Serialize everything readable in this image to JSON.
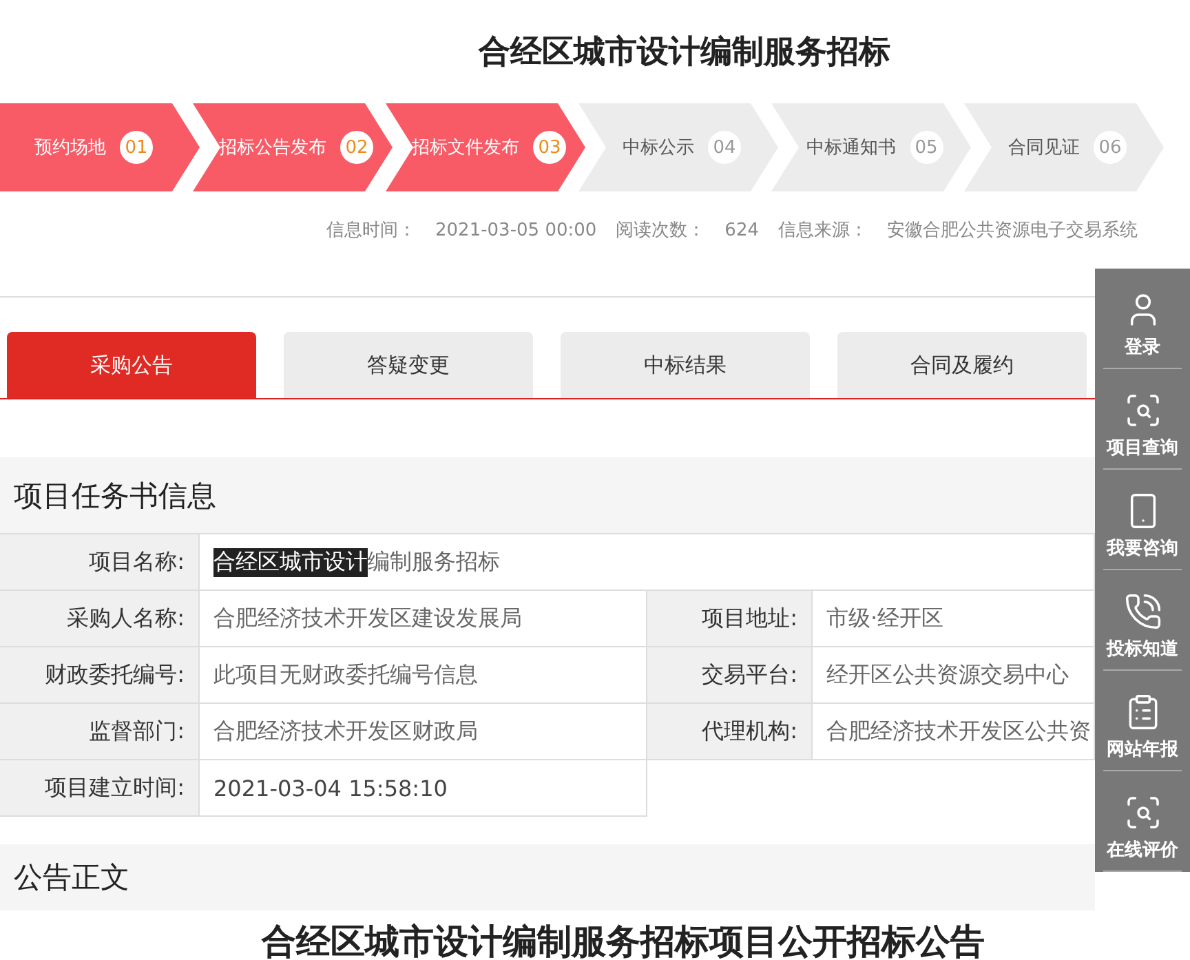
{
  "page_title": "合经区城市设计编制服务招标",
  "steps": [
    {
      "label": "预约场地",
      "number": "01",
      "done": true
    },
    {
      "label": "招标公告发布",
      "number": "02",
      "done": true
    },
    {
      "label": "招标文件发布",
      "number": "03",
      "done": true
    },
    {
      "label": "中标公示",
      "number": "04",
      "done": false
    },
    {
      "label": "中标通知书",
      "number": "05",
      "done": false
    },
    {
      "label": "合同见证",
      "number": "06",
      "done": false
    }
  ],
  "meta": [
    {
      "label": "信息时间：",
      "value": "2021-03-05 00:00"
    },
    {
      "label": "阅读次数：",
      "value": "624"
    },
    {
      "label": "信息来源：",
      "value": "安徽合肥公共资源电子交易系统"
    }
  ],
  "tabs": [
    {
      "label": "采购公告",
      "selected": true
    },
    {
      "label": "答疑变更",
      "selected": false
    },
    {
      "label": "中标结果",
      "selected": false
    },
    {
      "label": "合同及履约",
      "selected": false
    }
  ],
  "info_section": {
    "heading": "项目任务书信息",
    "name_row": {
      "label": "项目名称:",
      "value_parts": [
        {
          "text": "合经区城市设计",
          "selected": true
        },
        {
          "text": "编制服务招标",
          "selected": false
        }
      ]
    },
    "rows": [
      [
        {
          "label": "采购人名称:",
          "value": "合肥经济技术开发区建设发展局"
        },
        {
          "label": "项目地址:",
          "value": "市级·经开区"
        }
      ],
      [
        {
          "label": "财政委托编号:",
          "value": "此项目无财政委托编号信息"
        },
        {
          "label": "交易平台:",
          "value": "经开区公共资源交易中心"
        }
      ],
      [
        {
          "label": "监督部门:",
          "value": "合肥经济技术开发区财政局"
        },
        {
          "label": "代理机构:",
          "value": "合肥经济技术开发区公共资"
        }
      ],
      [
        {
          "label": "项目建立时间:",
          "value": "2021-03-04 15:58:10"
        }
      ]
    ]
  },
  "notice_section": {
    "heading": "公告正文",
    "title": "合经区城市设计编制服务招标项目公开招标公告"
  },
  "sidebar": [
    {
      "kind": "user",
      "label": "登录"
    },
    {
      "kind": "search",
      "label": "项目查询"
    },
    {
      "kind": "phone",
      "label": "我要咨询"
    },
    {
      "kind": "call",
      "label": "投标知道"
    },
    {
      "kind": "report",
      "label": "网站年报"
    },
    {
      "kind": "search",
      "label": "在线评价"
    }
  ]
}
